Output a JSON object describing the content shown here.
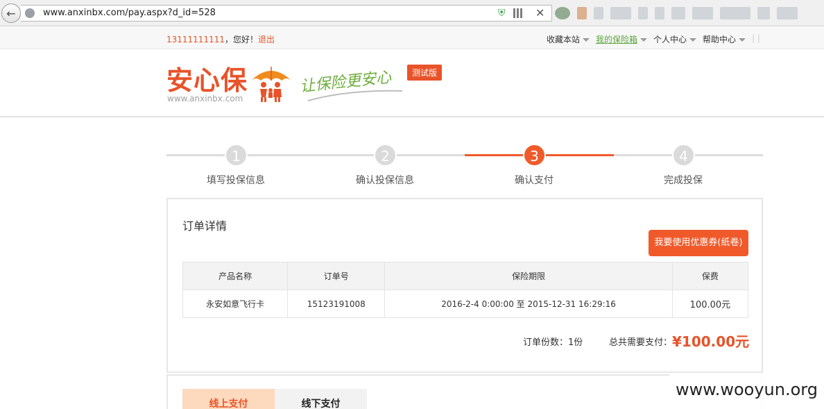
{
  "browser": {
    "url": "www.anxinbx.com/pay.aspx?d_id=528"
  },
  "topbar": {
    "phone": "13111111111",
    "greeting": "，您好！",
    "logout": "退出",
    "nav": {
      "bookmark": "收藏本站",
      "my_insurance": "我的保险箱",
      "personal": "个人中心",
      "help": "帮助中心"
    }
  },
  "header": {
    "logo": "安心保",
    "logo_url": "www.anxinbx.com",
    "slogan": "让保险更安心",
    "badge": "测试版"
  },
  "steps": [
    {
      "num": "1",
      "label": "填写投保信息",
      "active": false
    },
    {
      "num": "2",
      "label": "确认投保信息",
      "active": false
    },
    {
      "num": "3",
      "label": "确认支付",
      "active": true
    },
    {
      "num": "4",
      "label": "完成投保",
      "active": false
    }
  ],
  "order": {
    "title": "订单详情",
    "coupon_button": "我要使用优惠券(纸卷)",
    "columns": [
      "产品名称",
      "订单号",
      "保险期限",
      "保费"
    ],
    "row": {
      "product": "永安如意飞行卡",
      "order_no": "15123191008",
      "period": "2016-2-4 0:00:00 至 2015-12-31 16:29:16",
      "fee": "100.00元"
    },
    "count_label": "订单份数：1份",
    "total_label": "总共需要支付：",
    "total_amount": "¥100.00元"
  },
  "payment": {
    "online": "线上支付",
    "offline": "线下支付"
  },
  "watermark": "www.wooyun.org"
}
